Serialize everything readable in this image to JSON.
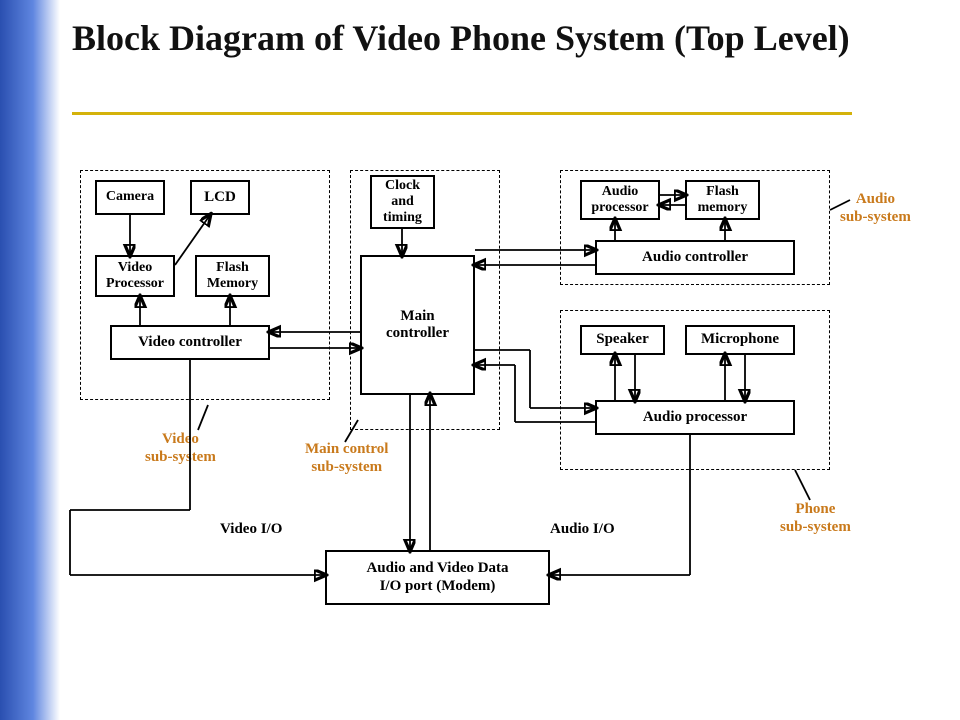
{
  "title": "Block Diagram of Video Phone System (Top Level)",
  "blocks": {
    "camera": "Camera",
    "lcd": "LCD",
    "video_processor": "Video\nProcessor",
    "flash_memory_v": "Flash\nMemory",
    "video_controller": "Video controller",
    "clock": "Clock\nand\ntiming",
    "main_controller": "Main\ncontroller",
    "audio_processor_top": "Audio\nprocessor",
    "flash_memory_a": "Flash\nmemory",
    "audio_controller": "Audio controller",
    "speaker": "Speaker",
    "microphone": "Microphone",
    "audio_processor_bottom": "Audio processor",
    "modem": "Audio and Video Data\nI/O port (Modem)"
  },
  "labels": {
    "video_sub": "Video\nsub-system",
    "main_sub": "Main control\nsub-system",
    "audio_sub": "Audio\nsub-system",
    "phone_sub": "Phone\nsub-system",
    "video_io": "Video I/O",
    "audio_io": "Audio I/O"
  }
}
